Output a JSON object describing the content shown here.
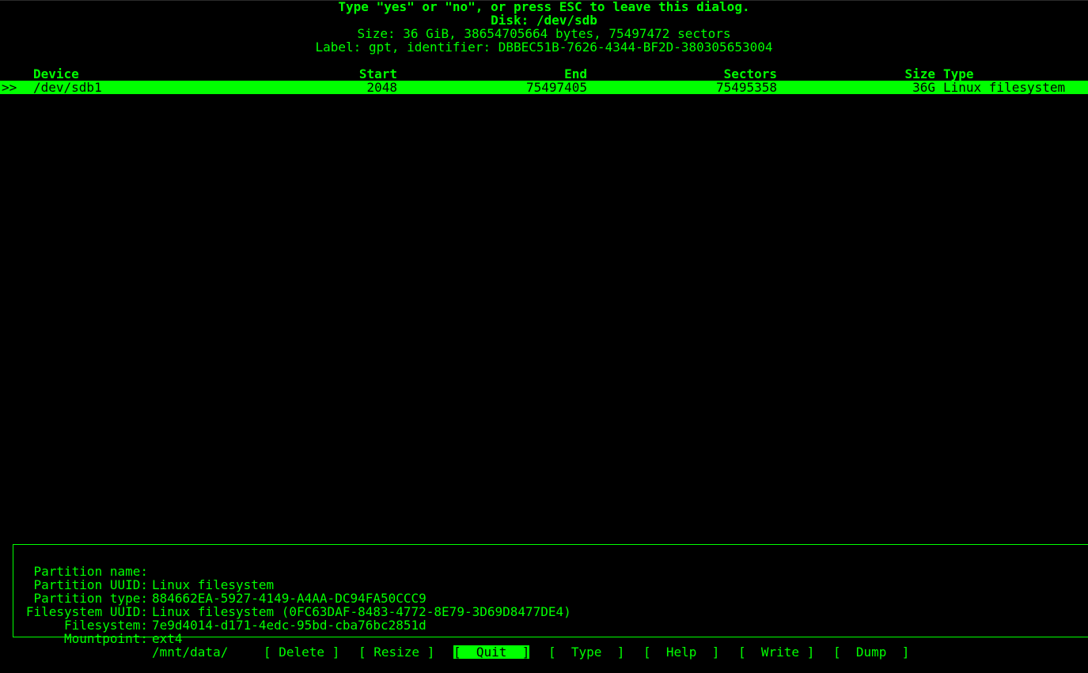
{
  "dialog": {
    "prompt": "Type \"yes\" or \"no\", or press ESC to leave this dialog.",
    "disk_line": "Disk: /dev/sdb",
    "size_line": "Size: 36 GiB, 38654705664 bytes, 75497472 sectors",
    "label_line": "Label: gpt, identifier: DBBEC51B-7626-4344-BF2D-380305653004"
  },
  "table": {
    "headers": {
      "device": "Device",
      "start": "Start",
      "end": "End",
      "sectors": "Sectors",
      "size": "Size",
      "type": "Type"
    },
    "rows": [
      {
        "cursor": ">>",
        "device": "/dev/sdb1",
        "start": "2048",
        "end": "75497405",
        "sectors": "75495358",
        "size": "36G",
        "type": "Linux filesystem",
        "selected": true
      }
    ]
  },
  "info": {
    "partition_name_label": "Partition name:",
    "partition_name_value": "Linux filesystem",
    "partition_uuid_label": "Partition UUID:",
    "partition_uuid_value": "884662EA-5927-4149-A4AA-DC94FA50CCC9",
    "partition_type_label": "Partition type:",
    "partition_type_value": "Linux filesystem (0FC63DAF-8483-4772-8E79-3D69D8477DE4)",
    "filesystem_uuid_label": "Filesystem UUID:",
    "filesystem_uuid_value": "7e9d4014-d171-4edc-95bd-cba76bc2851d",
    "filesystem_label": "Filesystem:",
    "filesystem_value": "ext4",
    "mountpoint_label": "Mountpoint:",
    "mountpoint_value": "/mnt/data/"
  },
  "menu": {
    "delete": "[ Delete ]",
    "resize": "[ Resize ]",
    "quit": "[  Quit  ]",
    "type": "[  Type  ]",
    "help": "[  Help  ]",
    "write": "[  Write ]",
    "dump": "[  Dump  ]",
    "selected": "quit"
  },
  "colors": {
    "foreground": "#00ff00",
    "background": "#000000"
  }
}
